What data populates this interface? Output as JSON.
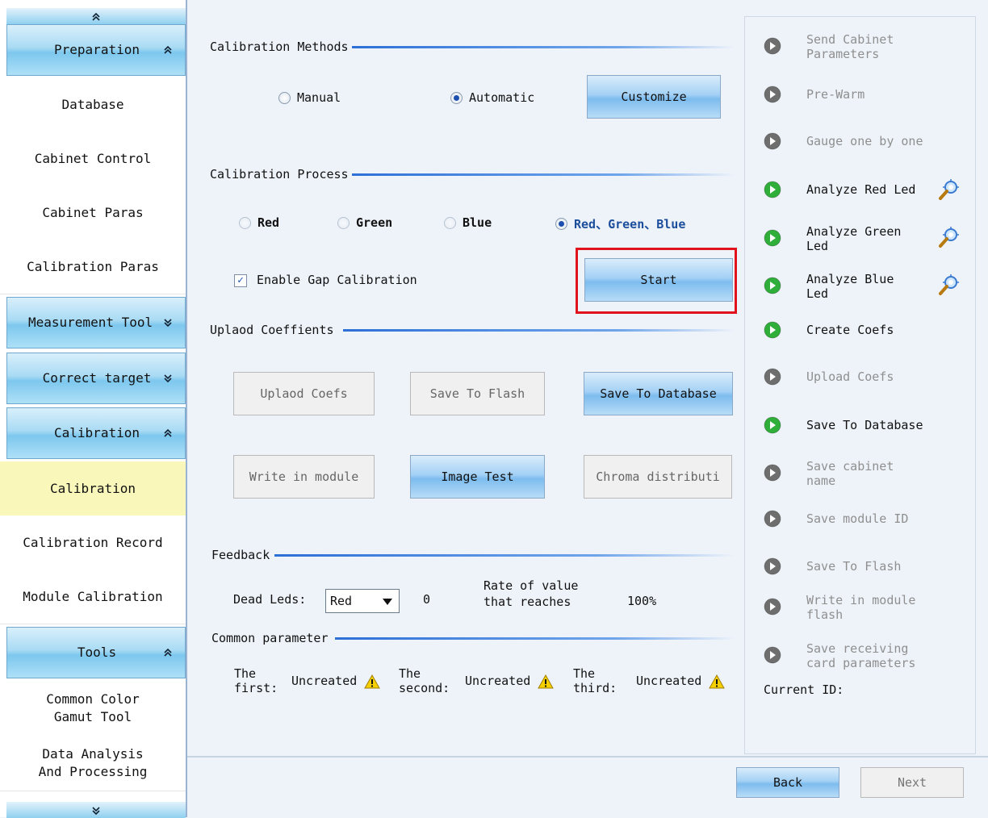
{
  "sidebar": {
    "scroll_up": "⌃",
    "scroll_down": "⌄",
    "sections": [
      {
        "label": "Preparation",
        "chevron": "≈"
      },
      {
        "label": "Measurement Tool",
        "chevron": "≈"
      },
      {
        "label": "Correct target",
        "chevron": "≈"
      },
      {
        "label": "Calibration",
        "chevron": "≈"
      },
      {
        "label": "Tools",
        "chevron": "≈"
      }
    ],
    "preparation_items": [
      "Database",
      "Cabinet Control",
      "Cabinet Paras",
      "Calibration Paras"
    ],
    "calibration_items": [
      "Calibration",
      "Calibration Record",
      "Module Calibration"
    ],
    "tools_items": [
      "Common Color Gamut Tool",
      "Data Analysis And Processing"
    ]
  },
  "methods": {
    "title": "Calibration Methods",
    "manual": "Manual",
    "automatic": "Automatic",
    "selected": "Automatic",
    "customize": "Customize"
  },
  "process": {
    "title": "Calibration Process",
    "options": [
      "Red",
      "Green",
      "Blue",
      "Red、Green、Blue"
    ],
    "selected": "Red、Green、Blue",
    "gap_label": "Enable Gap Calibration",
    "gap_checked": true,
    "start": "Start"
  },
  "upload": {
    "title": "Uplaod Coeffients",
    "upload_coefs": "Uplaod Coefs",
    "save_flash": "Save To Flash",
    "save_database": "Save To Database",
    "write_module": "Write in module",
    "image_test": "Image Test",
    "chroma": "Chroma distributi"
  },
  "feedback": {
    "title": "Feedback",
    "dead_leds_label": "Dead Leds:",
    "dead_leds_color": "Red",
    "dead_leds_value": "0",
    "rate_label_1": "Rate of value",
    "rate_label_2": "that reaches",
    "rate_value": "100%"
  },
  "common": {
    "title": "Common parameter",
    "first_1": "The",
    "first_2": "first:",
    "second_1": "The",
    "second_2": "second:",
    "third_1": "The",
    "third_2": "third:",
    "status": "Uncreated"
  },
  "steps": [
    {
      "l1": "Send Cabinet",
      "l2": "Parameters",
      "state": "disabled"
    },
    {
      "l1": "Pre-Warm",
      "l2": "",
      "state": "disabled"
    },
    {
      "l1": "Gauge one by one",
      "l2": "",
      "state": "disabled"
    },
    {
      "l1": "Analyze Red Led",
      "l2": "",
      "state": "active"
    },
    {
      "l1": "Analyze Green",
      "l2": "Led",
      "state": "active"
    },
    {
      "l1": "Analyze Blue",
      "l2": "Led",
      "state": "active"
    },
    {
      "l1": "Create Coefs",
      "l2": "",
      "state": "active"
    },
    {
      "l1": "Upload Coefs",
      "l2": "",
      "state": "disabled"
    },
    {
      "l1": "Save To Database",
      "l2": "",
      "state": "active"
    },
    {
      "l1": "Save cabinet",
      "l2": "name",
      "state": "disabled"
    },
    {
      "l1": "Save module ID",
      "l2": "",
      "state": "disabled"
    },
    {
      "l1": "Save To Flash",
      "l2": "",
      "state": "disabled"
    },
    {
      "l1": "Write in module",
      "l2": "flash",
      "state": "disabled"
    },
    {
      "l1": "Save receiving",
      "l2": "card parameters",
      "state": "disabled"
    }
  ],
  "current_id_label": "Current ID:",
  "footer": {
    "back": "Back",
    "next": "Next"
  },
  "colors": {
    "accent": "#2c6fd6",
    "highlight_box": "#e0131c",
    "selected_item": "#f9f7b9",
    "step_active": "#2fae3a",
    "step_disabled": "#6e6e6e"
  }
}
